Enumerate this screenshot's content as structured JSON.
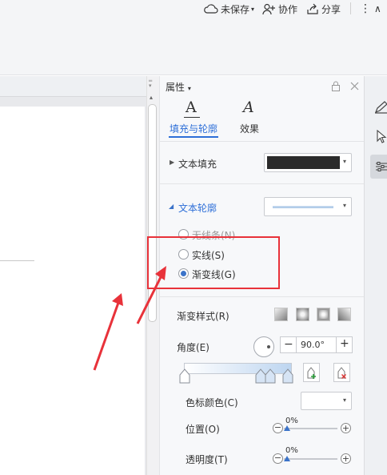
{
  "toolbar": {
    "unsaved_label": "未保存",
    "collab_label": "协作",
    "share_label": "分享",
    "more_glyph": "⋮",
    "collapse_glyph": "∧"
  },
  "panel": {
    "title": "属性",
    "tabs": [
      {
        "label": "填充与轮廓",
        "icon": "A",
        "active": true
      },
      {
        "label": "效果",
        "icon": "A",
        "active": false
      }
    ],
    "text_fill": {
      "label": "文本填充",
      "color": "#2b2b2b"
    },
    "text_outline": {
      "label": "文本轮廓",
      "options": [
        {
          "label": "无线条(N)",
          "checked": false
        },
        {
          "label": "实线(S)",
          "checked": false
        },
        {
          "label": "渐变线(G)",
          "checked": true
        }
      ]
    },
    "gradient_style_label": "渐变样式(R)",
    "angle": {
      "label": "角度(E)",
      "value": "90.0°"
    },
    "stop_color_label": "色标颜色(C)",
    "position": {
      "label": "位置(O)",
      "value": "0%",
      "fraction": 0.0
    },
    "transparency": {
      "label": "透明度(T)",
      "value": "0%",
      "fraction": 0.0
    }
  },
  "colors": {
    "accent": "#2e6fd8",
    "annotation": "#e8323a"
  }
}
